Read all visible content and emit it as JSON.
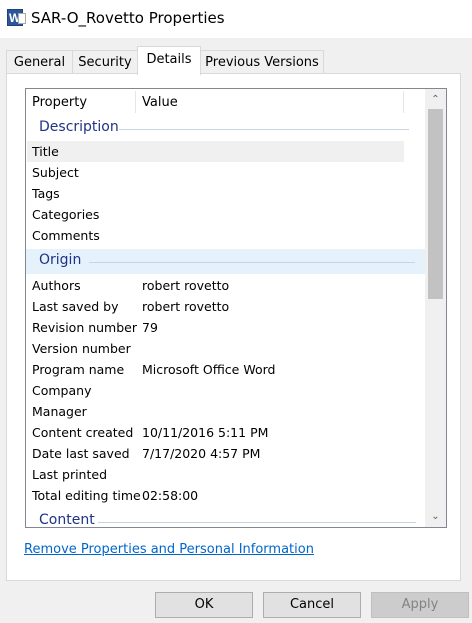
{
  "window": {
    "title": "SAR-O_Rovetto Properties",
    "app_icon_letter": "W"
  },
  "tabs": [
    "General",
    "Security",
    "Details",
    "Previous Versions"
  ],
  "active_tab": "Details",
  "columns": {
    "property": "Property",
    "value": "Value"
  },
  "groups": {
    "description": {
      "label": "Description",
      "rows": [
        {
          "property": "Title",
          "value": ""
        },
        {
          "property": "Subject",
          "value": ""
        },
        {
          "property": "Tags",
          "value": ""
        },
        {
          "property": "Categories",
          "value": ""
        },
        {
          "property": "Comments",
          "value": ""
        }
      ]
    },
    "origin": {
      "label": "Origin",
      "rows": [
        {
          "property": "Authors",
          "value": "robert rovetto"
        },
        {
          "property": "Last saved by",
          "value": "robert rovetto"
        },
        {
          "property": "Revision number",
          "value": "79"
        },
        {
          "property": "Version number",
          "value": ""
        },
        {
          "property": "Program name",
          "value": "Microsoft Office Word"
        },
        {
          "property": "Company",
          "value": ""
        },
        {
          "property": "Manager",
          "value": ""
        },
        {
          "property": "Content created",
          "value": "10/11/2016 5:11 PM"
        },
        {
          "property": "Date last saved",
          "value": "7/17/2020 4:57 PM"
        },
        {
          "property": "Last printed",
          "value": ""
        },
        {
          "property": "Total editing time",
          "value": "02:58:00"
        }
      ]
    },
    "content": {
      "label": "Content"
    }
  },
  "remove_link": "Remove Properties and Personal Information",
  "buttons": {
    "ok": "OK",
    "cancel": "Cancel",
    "apply": "Apply"
  },
  "icons": {
    "scroll_up": "chevron-up-icon",
    "scroll_down": "chevron-down-icon"
  }
}
